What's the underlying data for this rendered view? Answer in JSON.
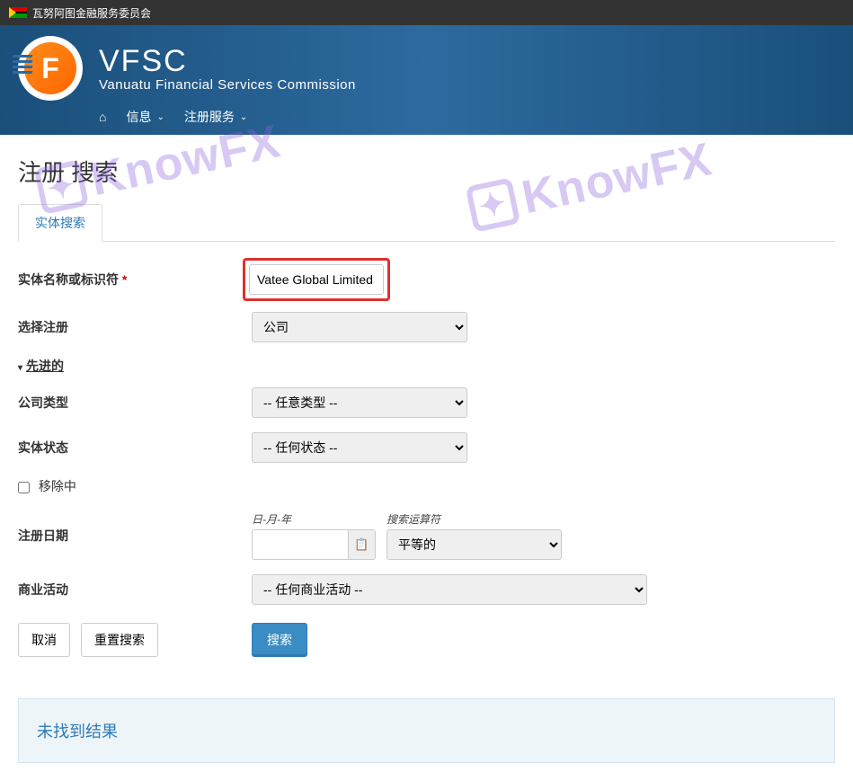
{
  "topbar": {
    "title": "瓦努阿图金融服务委员会"
  },
  "brand": {
    "title": "VFSC",
    "subtitle": "Vanuatu Financial Services Commission"
  },
  "nav": {
    "info": "信息",
    "register_services": "注册服务"
  },
  "page": {
    "title": "注册 搜索"
  },
  "tabs": {
    "entity_search": "实体搜索"
  },
  "form": {
    "entity_name_label": "实体名称或标识符",
    "entity_name_value": "Vatee Global Limited",
    "select_register_label": "选择注册",
    "select_register_value": "公司",
    "advanced_label": "先进的",
    "company_type_label": "公司类型",
    "company_type_value": "-- 任意类型 --",
    "entity_status_label": "实体状态",
    "entity_status_value": "-- 任何状态 --",
    "removing_label": "移除中",
    "reg_date_label": "注册日期",
    "date_placeholder": "日-月-年",
    "operator_label": "搜索运算符",
    "operator_value": "平等的",
    "business_activity_label": "商业活动",
    "business_activity_value": "-- 任何商业活动 --",
    "cancel": "取消",
    "reset": "重置搜索",
    "search": "搜索"
  },
  "results": {
    "no_results": "未找到结果"
  },
  "watermark": {
    "text": "KnowFX"
  }
}
